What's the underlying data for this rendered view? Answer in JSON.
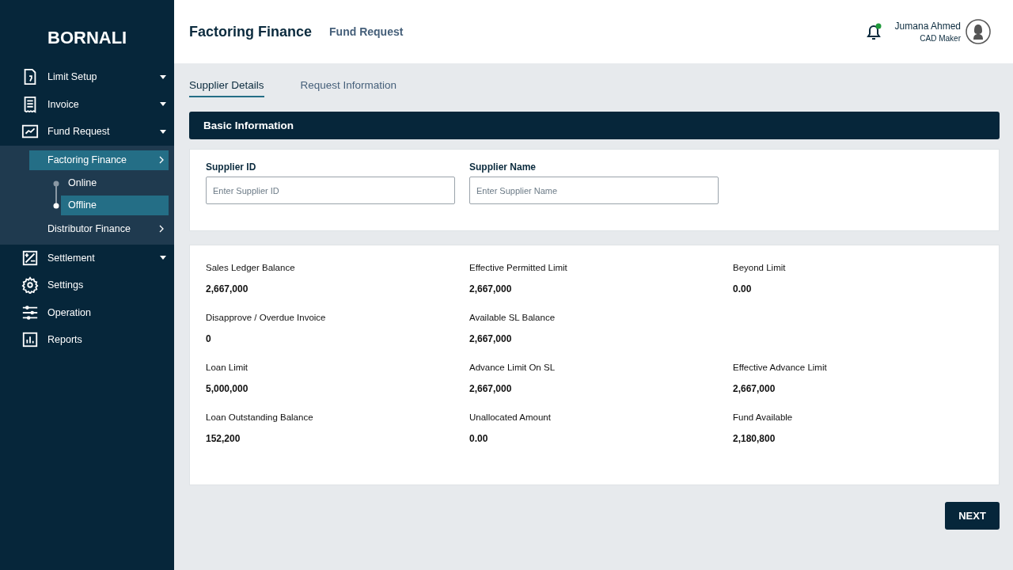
{
  "sidebar": {
    "logo": "BORNALI",
    "items": [
      {
        "label": "Limit Setup",
        "has_submenu": true
      },
      {
        "label": "Invoice",
        "has_submenu": true
      },
      {
        "label": "Fund Request",
        "expanded": true,
        "children": [
          {
            "label": "Factoring Finance",
            "selected": true,
            "children": [
              {
                "label": "Online",
                "selected": false
              },
              {
                "label": "Offline",
                "selected": true
              }
            ]
          },
          {
            "label": "Distributor Finance",
            "selected": false
          }
        ]
      },
      {
        "label": "Settlement",
        "has_submenu": true
      },
      {
        "label": "Settings"
      },
      {
        "label": "Operation"
      },
      {
        "label": "Reports"
      }
    ]
  },
  "header": {
    "title": "Factoring Finance",
    "subtitle": "Fund Request",
    "user": {
      "name": "Jumana Ahmed",
      "role": "CAD Maker"
    },
    "notification": true
  },
  "tabs": [
    {
      "label": "Supplier Details",
      "selected": true
    },
    {
      "label": "Request Information",
      "selected": false
    }
  ],
  "section_title": "Basic Information",
  "fields": [
    {
      "label": "Supplier ID",
      "placeholder": "Enter Supplier ID"
    },
    {
      "label": "Supplier Name",
      "placeholder": "Enter Supplier Name"
    }
  ],
  "stats": [
    [
      {
        "label": "Sales Ledger Balance",
        "value": "2,667,000"
      },
      {
        "label": "Effective Permitted Limit",
        "value": "2,667,000"
      },
      {
        "label": "Beyond Limit",
        "value": "0.00"
      }
    ],
    [
      {
        "label": "Disapprove / Overdue Invoice",
        "value": "0"
      },
      {
        "label": "Available SL Balance",
        "value": "2,667,000"
      }
    ],
    [
      {
        "label": "Loan Limit",
        "value": "5,000,000"
      },
      {
        "label": "Advance Limit On SL",
        "value": "2,667,000"
      },
      {
        "label": "Effective Advance Limit",
        "value": "2,667,000"
      }
    ],
    [
      {
        "label": "Loan Outstanding Balance",
        "value": "152,200"
      },
      {
        "label": "Unallocated Amount",
        "value": "0.00"
      },
      {
        "label": "Fund Available",
        "value": "2,180,800"
      }
    ]
  ],
  "next_button": "NEXT"
}
